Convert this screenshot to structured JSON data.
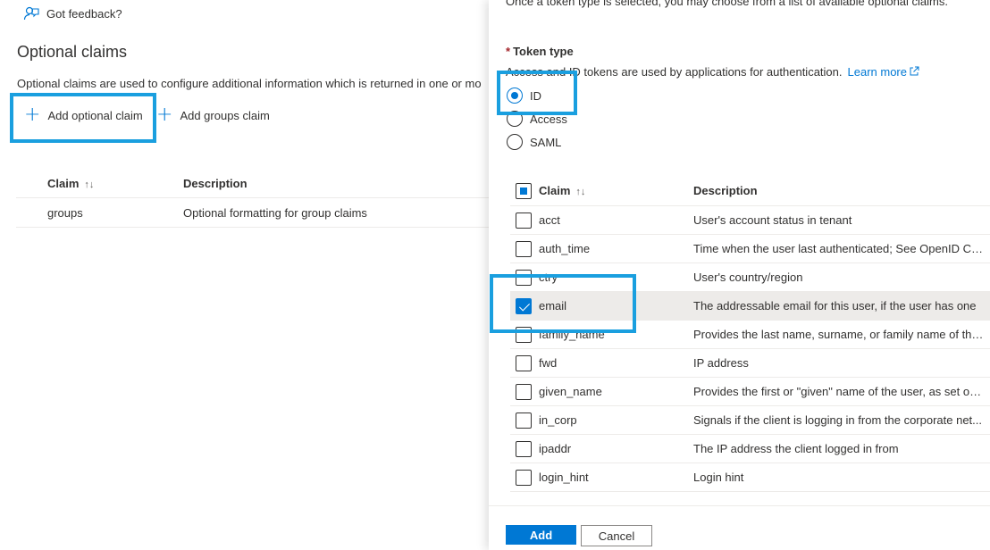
{
  "left": {
    "feedback_label": "Got feedback?",
    "title": "Optional claims",
    "description": "Optional claims are used to configure additional information which is returned in one or mo",
    "commands": {
      "add_optional_claim": "Add optional claim",
      "add_groups_claim": "Add groups claim"
    },
    "table": {
      "headers": {
        "claim": "Claim",
        "description": "Description"
      },
      "rows": [
        {
          "claim": "groups",
          "description": "Optional formatting for group claims"
        }
      ]
    }
  },
  "panel": {
    "intro_text": "Once a token type is selected, you may choose from a list of available optional claims.",
    "token_type_label": "Token type",
    "token_type_required_mark": "*",
    "token_type_desc": "Access and ID tokens are used by applications for authentication.",
    "learn_more": "Learn more",
    "token_types": [
      {
        "label": "ID",
        "selected": true
      },
      {
        "label": "Access",
        "selected": false
      },
      {
        "label": "SAML",
        "selected": false
      }
    ],
    "table": {
      "headers": {
        "claim": "Claim",
        "description": "Description"
      },
      "rows": [
        {
          "claim": "acct",
          "description": "User's account status in tenant",
          "checked": false
        },
        {
          "claim": "auth_time",
          "description": "Time when the user last authenticated; See OpenID Con...",
          "checked": false
        },
        {
          "claim": "ctry",
          "description": "User's country/region",
          "checked": false
        },
        {
          "claim": "email",
          "description": "The addressable email for this user, if the user has one",
          "checked": true
        },
        {
          "claim": "family_name",
          "description": "Provides the last name, surname, or family name of the ...",
          "checked": false
        },
        {
          "claim": "fwd",
          "description": "IP address",
          "checked": false
        },
        {
          "claim": "given_name",
          "description": "Provides the first or \"given\" name of the user, as set on ...",
          "checked": false
        },
        {
          "claim": "in_corp",
          "description": "Signals if the client is logging in from the corporate net...",
          "checked": false
        },
        {
          "claim": "ipaddr",
          "description": "The IP address the client logged in from",
          "checked": false
        },
        {
          "claim": "login_hint",
          "description": "Login hint",
          "checked": false
        }
      ]
    },
    "buttons": {
      "add": "Add",
      "cancel": "Cancel"
    }
  },
  "colors": {
    "accent": "#0078d4",
    "highlight_box": "#1a9fdf",
    "required": "#a4262c"
  },
  "icons": {
    "feedback": "feedback-person-icon",
    "add": "plus-icon",
    "sort": "sort-arrows-icon",
    "external_link": "external-link-icon"
  }
}
